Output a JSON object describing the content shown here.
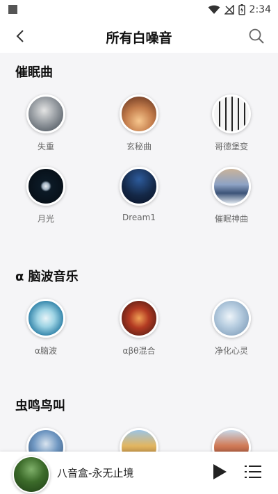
{
  "status": {
    "time": "2:34"
  },
  "appbar": {
    "title": "所有白噪音"
  },
  "sections": [
    {
      "title": "催眠曲",
      "items": [
        {
          "label": "失重",
          "color": "#8a8f96"
        },
        {
          "label": "玄秘曲",
          "color": "#c9875a"
        },
        {
          "label": "哥德堡变",
          "color": "#222222"
        },
        {
          "label": "月光",
          "color": "#0e2231"
        },
        {
          "label": "Dream1",
          "color": "#1f3b6a"
        },
        {
          "label": "催眠神曲",
          "color": "#7a8fb8"
        }
      ]
    },
    {
      "title": "α 脑波音乐",
      "items": [
        {
          "label": "α脑波",
          "color": "#2f8fb0"
        },
        {
          "label": "αβθ混合",
          "color": "#a8321f"
        },
        {
          "label": "净化心灵",
          "color": "#8fb2cf"
        }
      ]
    },
    {
      "title": "虫鸣鸟叫",
      "items": [
        {
          "label": "",
          "color": "#4f7fb5"
        },
        {
          "label": "",
          "color": "#d2a253"
        },
        {
          "label": "",
          "color": "#b5553f"
        }
      ]
    }
  ],
  "player": {
    "track": "八音盒-永无止境"
  }
}
